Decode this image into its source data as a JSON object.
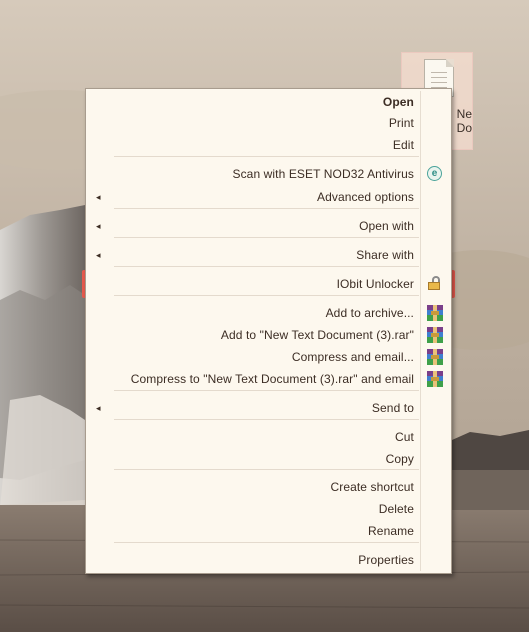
{
  "desktop": {
    "file_label": "Ne\nDo",
    "icon": "text-document-icon"
  },
  "menu": {
    "items": [
      {
        "label": "Open",
        "bold": true
      },
      {
        "label": "Print"
      },
      {
        "label": "Edit"
      },
      {
        "label": "Scan with ESET NOD32 Antivirus",
        "icon": "eset-icon"
      },
      {
        "label": "Advanced options",
        "submenu": true
      },
      {
        "label": "Open with",
        "submenu": true
      },
      {
        "label": "Share with",
        "submenu": true
      },
      {
        "label": "IObit Unlocker",
        "icon": "unlock-icon",
        "highlighted": true
      },
      {
        "label": "Add to archive...",
        "icon": "winrar-icon"
      },
      {
        "label": "Add to \"New Text Document (3).rar\"",
        "icon": "winrar-icon"
      },
      {
        "label": "Compress and email...",
        "icon": "winrar-icon"
      },
      {
        "label": "Compress to \"New Text Document (3).rar\" and email",
        "icon": "winrar-icon"
      },
      {
        "label": "Send to",
        "submenu": true
      },
      {
        "label": "Cut"
      },
      {
        "label": "Copy"
      },
      {
        "label": "Create shortcut"
      },
      {
        "label": "Delete"
      },
      {
        "label": "Rename"
      },
      {
        "label": "Properties"
      }
    ],
    "submenu_arrow": "◂",
    "eset_glyph": "e"
  },
  "colors": {
    "highlight_border": "#e65a4d",
    "menu_bg": "#fdf8ee",
    "text": "#3c2d24"
  }
}
